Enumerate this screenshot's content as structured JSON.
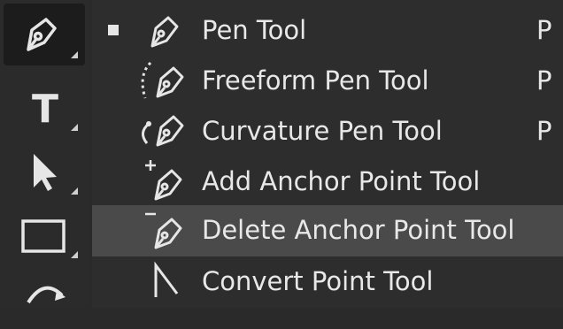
{
  "toolbar": {
    "tools": [
      {
        "name": "pen-tool",
        "icon": "pen-icon",
        "active": true
      },
      {
        "name": "type-tool",
        "icon": "type-icon",
        "label": "T"
      },
      {
        "name": "path-selection-tool",
        "icon": "arrow-cursor-icon"
      },
      {
        "name": "rectangle-tool",
        "icon": "rectangle-icon"
      },
      {
        "name": "hand-rotate-tool",
        "icon": "rotate-view-icon"
      }
    ]
  },
  "flyout": {
    "items": [
      {
        "label": "Pen Tool",
        "shortcut": "P",
        "icon": "pen-icon",
        "selected": true,
        "highlighted": false
      },
      {
        "label": "Freeform Pen Tool",
        "shortcut": "P",
        "icon": "freeform-pen-icon",
        "selected": false,
        "highlighted": false
      },
      {
        "label": "Curvature Pen Tool",
        "shortcut": "P",
        "icon": "curvature-pen-icon",
        "selected": false,
        "highlighted": false
      },
      {
        "label": "Add Anchor Point Tool",
        "shortcut": "",
        "icon": "add-anchor-point-icon",
        "selected": false,
        "highlighted": false
      },
      {
        "label": "Delete Anchor Point Tool",
        "shortcut": "",
        "icon": "delete-anchor-point-icon",
        "selected": false,
        "highlighted": true
      },
      {
        "label": "Convert Point Tool",
        "shortcut": "",
        "icon": "convert-point-icon",
        "selected": false,
        "highlighted": false
      }
    ]
  },
  "colors": {
    "background": "#2a2a2a",
    "menu_background": "#2d2d2d",
    "highlight": "#4a4a4a",
    "text": "#e8e8e8"
  }
}
